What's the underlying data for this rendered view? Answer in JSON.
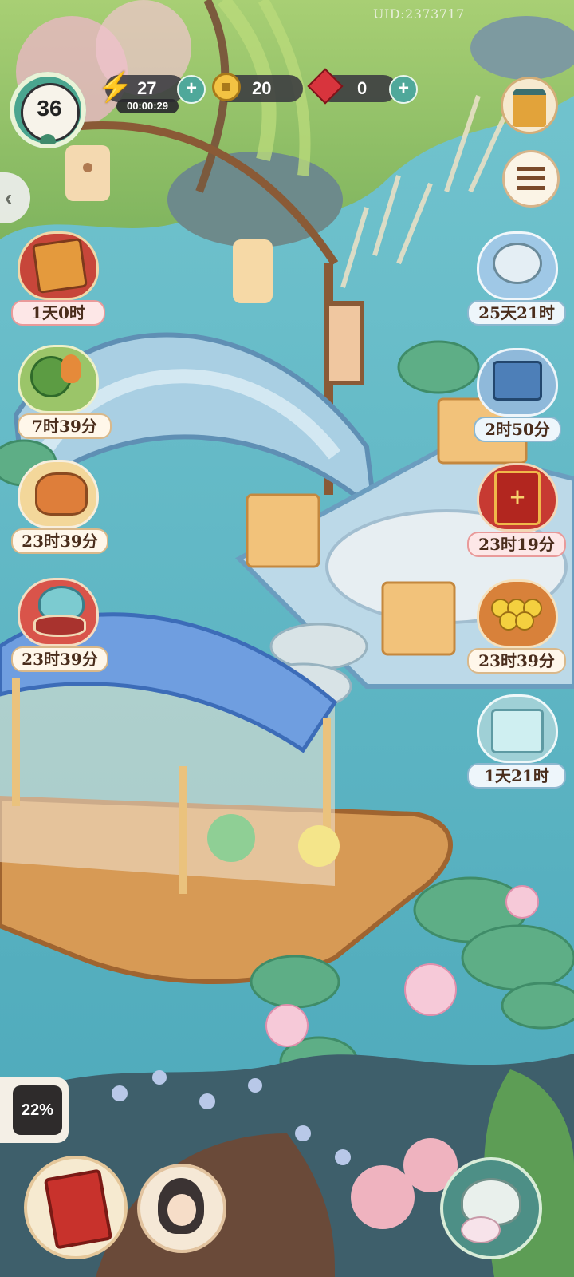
{
  "uid": "UID:2373717",
  "player": {
    "level": "36"
  },
  "resources": {
    "energy": {
      "value": "27",
      "timer": "00:00:29",
      "icon": "lightning-icon"
    },
    "coins": {
      "value": "20",
      "icon": "coin-icon"
    },
    "gems": {
      "value": "0",
      "icon": "red-gem-icon"
    }
  },
  "left_events": [
    {
      "name": "autumn-scroll-event",
      "timer": "1天0时",
      "style": "red"
    },
    {
      "name": "cabbage-vegetable-event",
      "timer": "7时39分",
      "style": "green"
    },
    {
      "name": "fox-event",
      "timer": "23时39分",
      "style": "gold"
    },
    {
      "name": "cat-drum-event",
      "timer": "23时39分",
      "style": "red"
    }
  ],
  "right_events": [
    {
      "name": "cat-cloud-event",
      "timer": "25天21时",
      "style": "blue"
    },
    {
      "name": "blue-gift-event",
      "timer": "2时50分",
      "style": "blue"
    },
    {
      "name": "plus-one-event",
      "timer": "23时19分",
      "style": "red"
    },
    {
      "name": "coin-stack-event",
      "timer": "23时39分",
      "style": "gold"
    },
    {
      "name": "ice-cat-gift-event",
      "timer": "1天21时",
      "style": "blue"
    }
  ],
  "progress": {
    "percent_label": "22%",
    "percent": 22
  },
  "colors": {
    "water": "#5fb9c8",
    "grass": "#9cc86a",
    "hud_dark": "#3a3a40",
    "plus_green": "#4fa89a"
  }
}
